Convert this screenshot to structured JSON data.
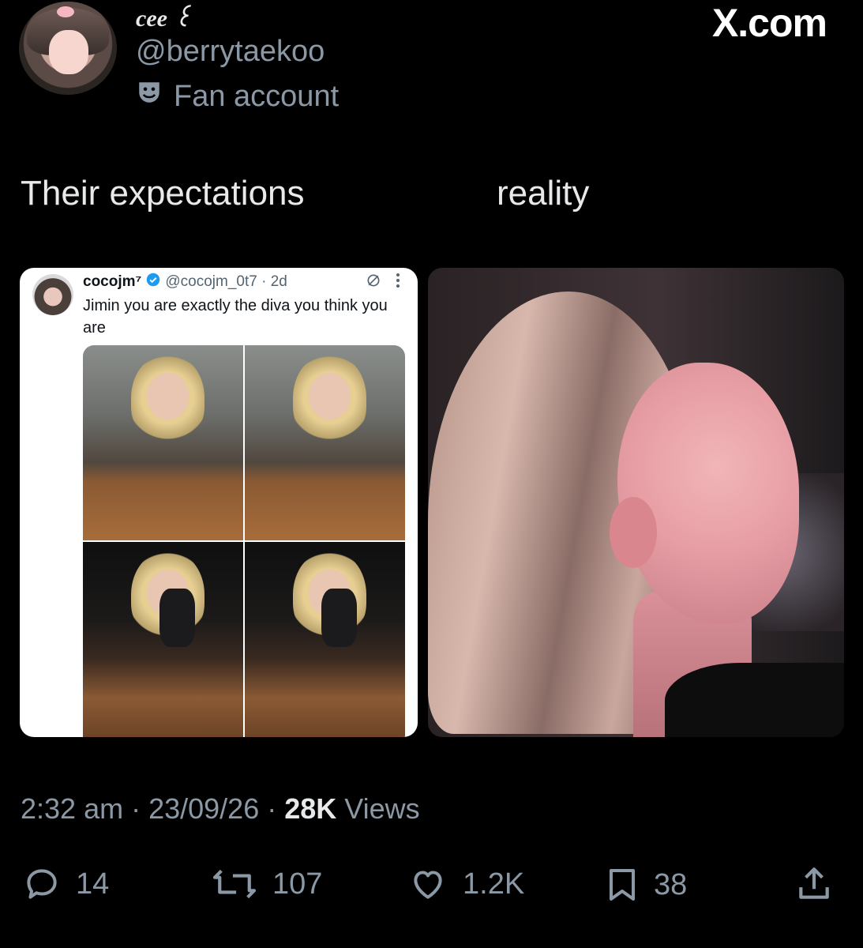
{
  "header": {
    "display_name": "cee ꒰ ",
    "handle": "@berrytaekoo",
    "badge_icon": "theater-mask-icon",
    "badge_label": "Fan account",
    "watermark": "X.com"
  },
  "post": {
    "left_label": "Their expectations",
    "right_label": "reality",
    "quoted_tweet": {
      "name": "cocojm⁷",
      "verified_icon": "verified-badge-icon",
      "handle_time": "@cocojm_0t7 · 2d",
      "text": "Jimin you are exactly the diva you think you are"
    }
  },
  "meta": {
    "time": "2:32 am",
    "sep1": " · ",
    "date": "23/09/26",
    "sep2": " · ",
    "views_count": "28K",
    "views_label": " Views"
  },
  "actions": {
    "replies": "14",
    "reposts": "107",
    "likes": "1.2K",
    "bookmarks": "38"
  },
  "colors": {
    "background": "#000000",
    "text": "#e7e9ea",
    "muted": "#8b98a5",
    "verified": "#1d9bf0"
  }
}
